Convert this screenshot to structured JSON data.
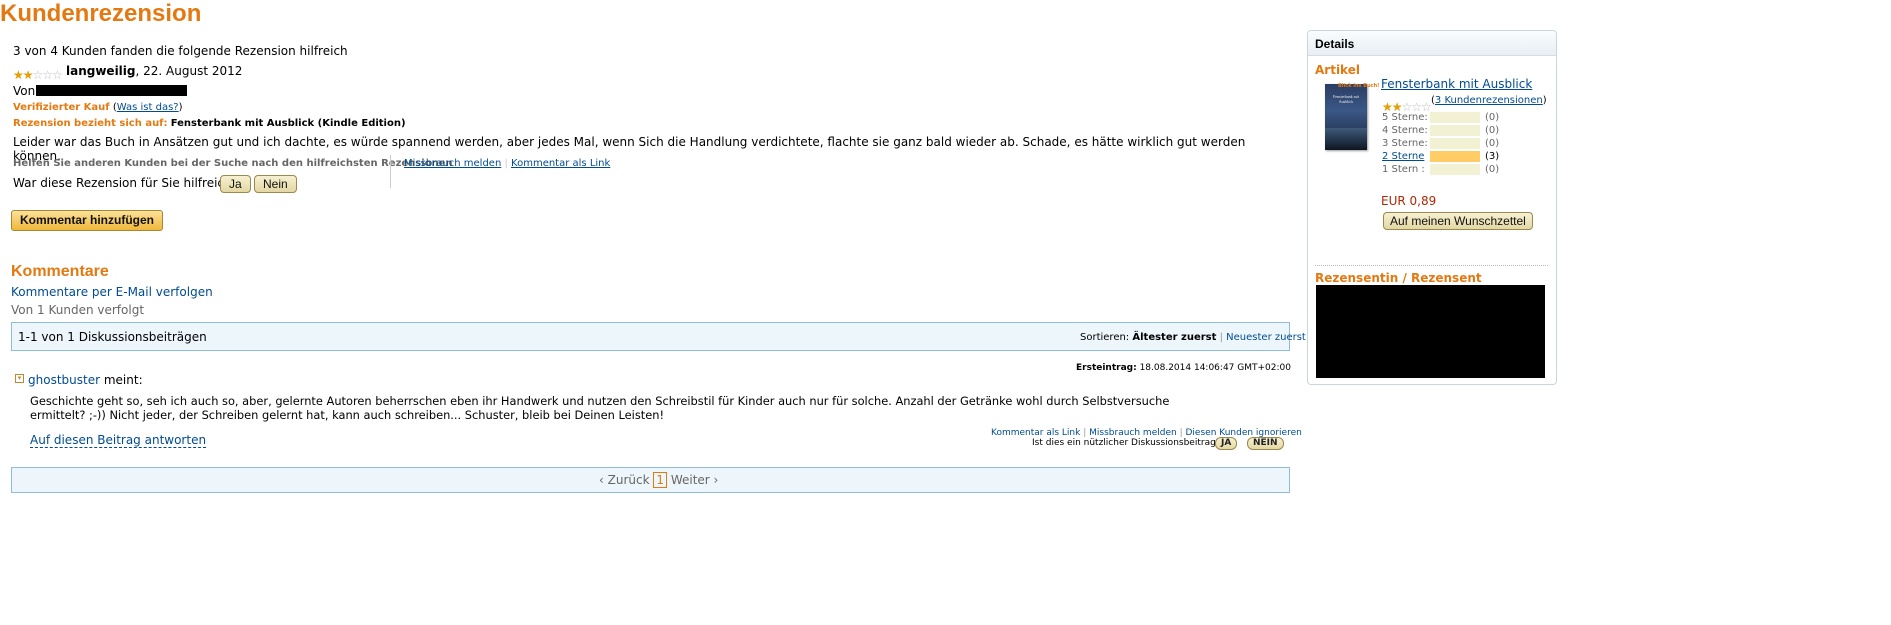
{
  "page_title": "Kundenrezension",
  "review": {
    "helpful_count": "3 von 4 Kunden fanden die folgende Rezension hilfreich",
    "rating_fraction": 0.4,
    "headline": "langweilig",
    "date": ", 22. August 2012",
    "by_label": "Von",
    "verified": "Verifizierter Kauf",
    "verified_help_open": "(",
    "verified_help_link": "Was ist das?",
    "verified_help_close": ")",
    "refers_label": "Rezension bezieht sich auf:",
    "refers_item": "Fensterbank mit Ausblick (Kindle Edition)",
    "body": "Leider war das Buch in Ansätzen gut und ich dachte, es würde spannend werden, aber jedes Mal, wenn Sich die Handlung verdichtete, flachte sie ganz bald wieder ab. Schade, es hätte wirklich gut werden können.",
    "help_others": "Helfen Sie anderen Kunden bei der Suche nach den hilfreichsten Rezensionen",
    "question": "War diese Rezension für Sie hilfreich?",
    "yes": "Ja",
    "no": "Nein",
    "report_abuse": "Missbrauch melden",
    "comment_link": "Kommentar als Link",
    "add_comment": "Kommentar hinzufügen"
  },
  "comments": {
    "heading": "Kommentare",
    "follow_email": "Kommentare per E-Mail verfolgen",
    "followed_by": "Von 1 Kunden verfolgt",
    "count": "1-1 von 1 Diskussionsbeiträgen",
    "sort_label": "Sortieren:",
    "sort_oldest": "Ältester zuerst",
    "sort_sep": "|",
    "sort_newest": "Neuester zuerst",
    "post": {
      "first_post_label": "Ersteintrag:",
      "first_post_date": "18.08.2014 14:06:47 GMT+02:00",
      "author": "ghostbuster",
      "says": "meint:",
      "text_line1": "Geschichte geht so, seh ich auch so, aber, gelernte Autoren beherrschen eben ihr Handwerk und nutzen den Schreibstil für Kinder auch nur für solche. Anzahl der Getränke wohl durch Selbstversuche",
      "text_line2": "ermittelt? ;-)) Nicht jeder, der Schreiben gelernt hat, kann auch schreiben... Schuster, bleib bei Deinen Leisten!",
      "reply": "Auf diesen Beitrag antworten",
      "comment_link": "Kommentar als Link",
      "report": "Missbrauch melden",
      "ignore": "Diesen Kunden ignorieren",
      "sep": "|",
      "useful_q": "Ist dies ein nützlicher Diskussionsbeitrag?",
      "yes": "JA",
      "no": "NEIN"
    },
    "pagination": {
      "prev": "‹ Zurück",
      "current": "1",
      "next": "Weiter ›"
    }
  },
  "sidebar": {
    "heading": "Details",
    "article_label": "Artikel",
    "product_title": "Fensterbank mit Ausblick",
    "rating_fraction": 0.4,
    "reviews_link": "3 Kundenrezensionen",
    "reviews_open": "(",
    "reviews_close": ")",
    "histogram": [
      {
        "label": "5 Sterne:",
        "count": "(0)",
        "fraction": 0,
        "link": false
      },
      {
        "label": "4 Sterne:",
        "count": "(0)",
        "fraction": 0,
        "link": false
      },
      {
        "label": "3 Sterne:",
        "count": "(0)",
        "fraction": 0,
        "link": false
      },
      {
        "label": "2 Sterne",
        "count": "(3)",
        "fraction": 1,
        "link": true
      },
      {
        "label": "1 Stern  :",
        "count": "(0)",
        "fraction": 0,
        "link": false
      }
    ],
    "price": "EUR 0,89",
    "wishlist": "Auf meinen Wunschzettel",
    "reviewer_label": "Rezensentin / Rezensent",
    "cover_text": "Fensterbank mit Ausblick",
    "cover_tag": "Blick ins Buch!"
  },
  "colors": {
    "accent": "#e47911",
    "link": "#004b91",
    "price": "#b12704"
  }
}
